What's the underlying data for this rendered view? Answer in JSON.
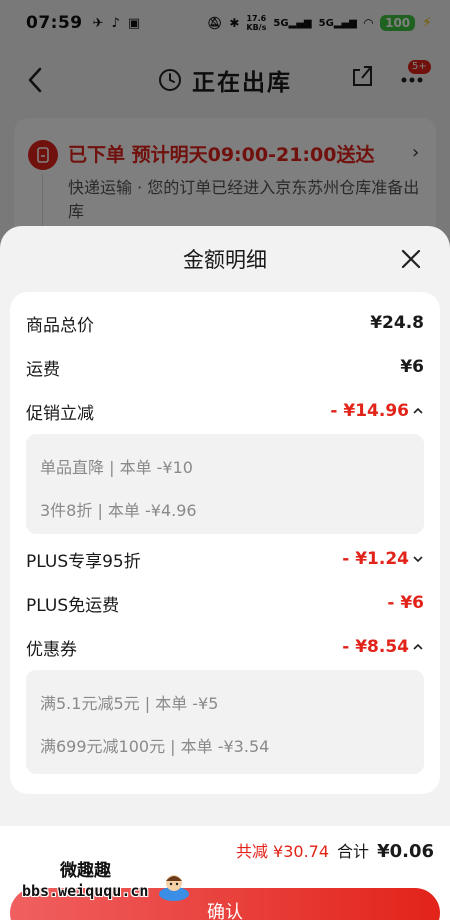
{
  "status_bar": {
    "time": "07:59",
    "net_speed_value": "17.6",
    "net_speed_unit": "KB/s",
    "signal1": "5G",
    "signal2": "5G",
    "battery": "100"
  },
  "nav": {
    "title": "正在出库",
    "badge": "5+"
  },
  "order": {
    "status": "已下单  预计明天09:00-21:00送达",
    "description": "快递运输 · 您的订单已经进入京东苏州仓库准备出库"
  },
  "sheet": {
    "title": "金额明细",
    "rows": [
      {
        "label": "商品总价",
        "value": "¥24.8"
      },
      {
        "label": "运费",
        "value": "¥6"
      },
      {
        "label": "促销立减",
        "value": "- ¥14.96"
      },
      {
        "label": "PLUS专享95折",
        "value": "- ¥1.24"
      },
      {
        "label": "PLUS免运费",
        "value": "- ¥6"
      },
      {
        "label": "优惠券",
        "value": "- ¥8.54"
      }
    ],
    "promo_details": [
      "单品直降 | 本单 -¥10",
      "3件8折 | 本单 -¥4.96"
    ],
    "coupon_details": [
      "满5.1元减5元 | 本单 -¥5",
      "满699元减100元 | 本单 -¥3.54"
    ]
  },
  "footer": {
    "total_reduce": "共减 ¥30.74",
    "total_label": "合计",
    "total_value": "¥0.06",
    "confirm_label": "确认"
  },
  "watermark": {
    "top": "微趣趣",
    "bottom": "bbs.weiququ.cn"
  },
  "colors": {
    "accent": "#e2231a",
    "sub_text": "#8a8a8a",
    "sheet_bg": "#f2f2f2"
  }
}
